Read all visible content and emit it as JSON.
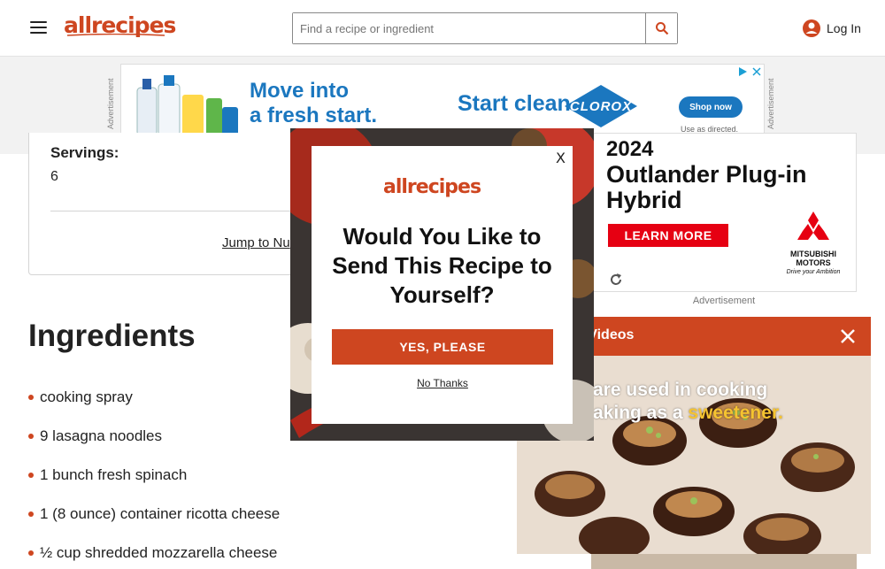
{
  "header": {
    "logo": "allrecipes",
    "search_placeholder": "Find a recipe or ingredient",
    "login_label": "Log In"
  },
  "top_ad": {
    "side_label": "Advertisement",
    "headline": "Move into\na fresh start.",
    "start_text": "Start clean.",
    "brand": "CLOROX",
    "cta": "Shop now",
    "disclaimer": "Use as directed."
  },
  "recipe": {
    "servings_label": "Servings:",
    "servings_value": "6",
    "jump_link": "Jump to Nu"
  },
  "ingredients": {
    "title": "Ingredients",
    "items": [
      "cooking spray",
      "9 lasagna noodles",
      "1 bunch fresh spinach",
      "1 (8 ounce) container ricotta cheese",
      "½ cup shredded mozzarella cheese"
    ]
  },
  "right_ad": {
    "year": "2024",
    "title": "Outlander Plug-in\nHybrid",
    "cta": "LEARN MORE",
    "brand": "MITSUBISHI\nMOTORS",
    "tagline": "Drive your Ambition",
    "label": "Advertisement"
  },
  "video": {
    "title": "ding Videos",
    "caption_line1": "are used in cooking",
    "caption_line2": "aking as a ",
    "caption_highlight": "sweetener."
  },
  "modal": {
    "logo": "allrecipes",
    "heading": "Would You Like to Send This Recipe to Yourself?",
    "yes_label": "YES, PLEASE",
    "no_label": "No Thanks",
    "close_label": "X"
  },
  "colors": {
    "brand": "#ce4620",
    "clorox_blue": "#1b77bf",
    "mitsubishi_red": "#e60012"
  }
}
